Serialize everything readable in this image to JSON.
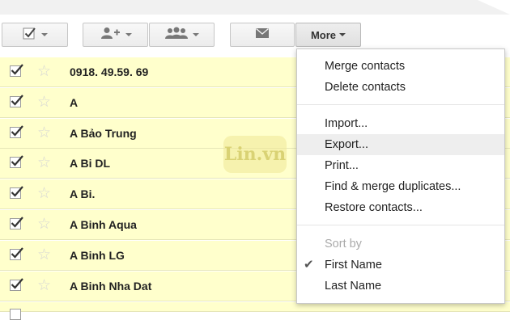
{
  "toolbar": {
    "more_label": "More",
    "icons": [
      "checkbox-icon",
      "add-person-icon",
      "group-icon",
      "mail-icon"
    ]
  },
  "contacts": [
    {
      "name": "0918. 49.59. 69",
      "checked": true
    },
    {
      "name": "A",
      "checked": true
    },
    {
      "name": "A Bảo Trung",
      "checked": true
    },
    {
      "name": "A Bi DL",
      "checked": true
    },
    {
      "name": "A Bi.",
      "checked": true
    },
    {
      "name": "A Binh Aqua",
      "checked": true
    },
    {
      "name": "A Binh LG",
      "checked": true
    },
    {
      "name": "A Binh Nha Dat",
      "checked": true
    }
  ],
  "watermark": "Lin.vn",
  "menu": {
    "merge": "Merge contacts",
    "delete": "Delete contacts",
    "import": "Import...",
    "export": "Export...",
    "print": "Print...",
    "find_merge": "Find & merge duplicates...",
    "restore": "Restore contacts...",
    "sort_by": "Sort by",
    "first_name": "First Name",
    "last_name": "Last Name"
  }
}
